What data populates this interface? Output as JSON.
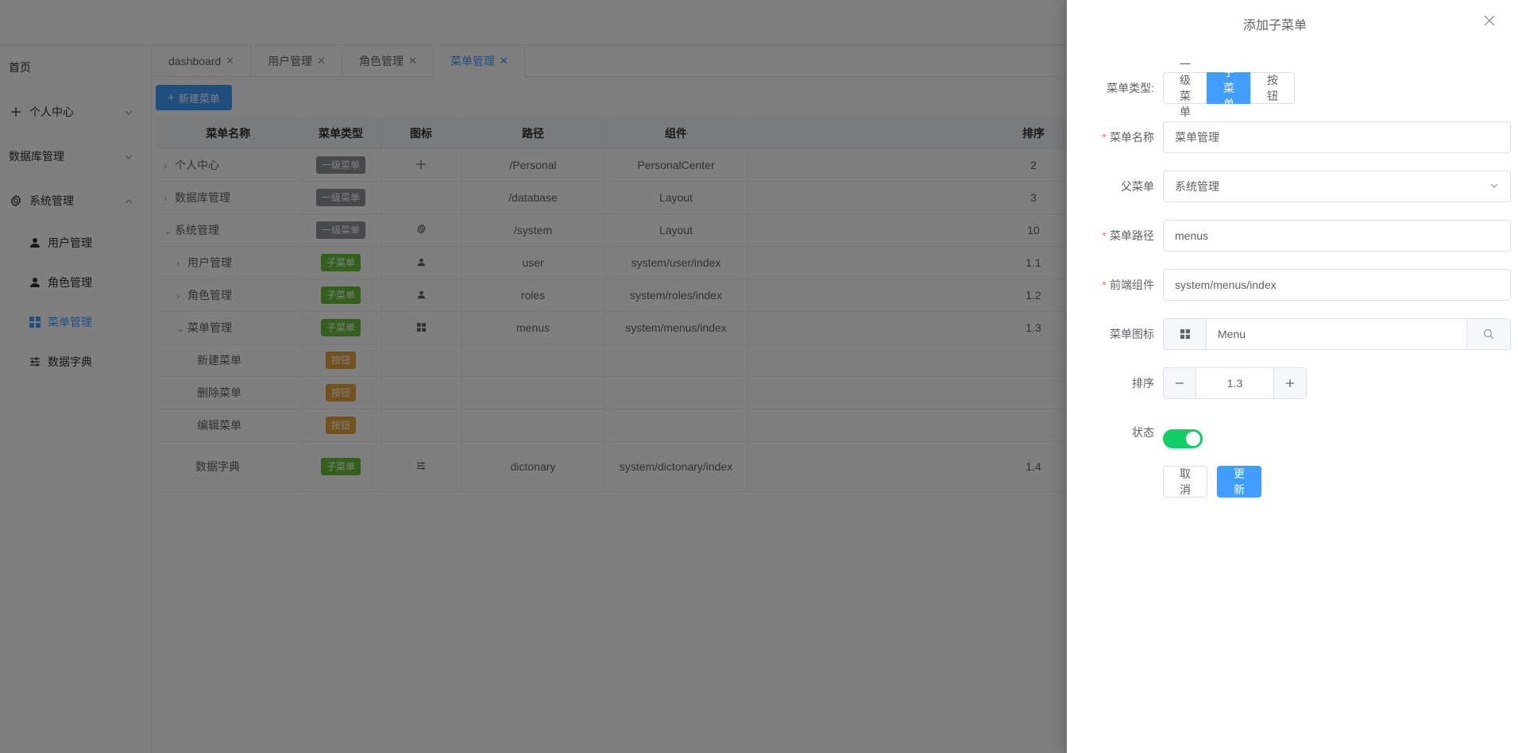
{
  "sidebar": {
    "home": "首页",
    "personal": "个人中心",
    "database": "数据库管理",
    "system": "系统管理",
    "sub_items": [
      {
        "label": "用户管理",
        "icon": "user-icon"
      },
      {
        "label": "角色管理",
        "icon": "user-icon"
      },
      {
        "label": "菜单管理",
        "icon": "grid-icon",
        "active": true
      },
      {
        "label": "数据字典",
        "icon": "sliders-icon"
      }
    ]
  },
  "tabs": [
    {
      "label": "dashboard"
    },
    {
      "label": "用户管理"
    },
    {
      "label": "角色管理"
    },
    {
      "label": "菜单管理",
      "active": true
    }
  ],
  "toolbar": {
    "new_menu": "新建菜单"
  },
  "table": {
    "headers": [
      "菜单名称",
      "菜单类型",
      "图标",
      "路径",
      "组件",
      "排序"
    ],
    "rows": [
      {
        "name": "个人中心",
        "type": "一级菜单",
        "path": "/Personal",
        "component": "PersonalCenter",
        "sort": "2"
      },
      {
        "name": "数据库管理",
        "type": "一级菜单",
        "path": "/database",
        "component": "Layout",
        "sort": "3"
      },
      {
        "name": "系统管理",
        "type": "一级菜单",
        "path": "/system",
        "component": "Layout",
        "sort": "10"
      },
      {
        "name": "用户管理",
        "type": "子菜单",
        "path": "user",
        "component": "system/user/index",
        "sort": "1.1"
      },
      {
        "name": "角色管理",
        "type": "子菜单",
        "path": "roles",
        "component": "system/roles/index",
        "sort": "1.2"
      },
      {
        "name": "菜单管理",
        "type": "子菜单",
        "path": "menus",
        "component": "system/menus/index",
        "sort": "1.3"
      },
      {
        "name": "新建菜单",
        "type": "按钮",
        "path": "",
        "component": "",
        "sort": ""
      },
      {
        "name": "删除菜单",
        "type": "按钮",
        "path": "",
        "component": "",
        "sort": ""
      },
      {
        "name": "编辑菜单",
        "type": "按钮",
        "path": "",
        "component": "",
        "sort": ""
      },
      {
        "name": "数据字典",
        "type": "子菜单",
        "path": "dictonary",
        "component": "system/dictonary/index",
        "sort": "1.4"
      }
    ]
  },
  "drawer": {
    "title": "添加子菜单",
    "type_label": "菜单类型:",
    "type_options": [
      "一级菜单",
      "子菜单",
      "按钮"
    ],
    "type_selected": "子菜单",
    "name_label": "菜单名称",
    "name_value": "菜单管理",
    "parent_label": "父菜单",
    "parent_value": "系统管理",
    "path_label": "菜单路径",
    "path_value": "menus",
    "component_label": "前端组件",
    "component_value": "system/menus/index",
    "icon_label": "菜单图标",
    "icon_value": "Menu",
    "sort_label": "排序",
    "sort_value": "1.3",
    "status_label": "状态",
    "status_on": true,
    "cancel": "取消",
    "submit": "更新"
  },
  "colors": {
    "primary": "#409eff",
    "switch_on": "#13ce66",
    "tag_gray": "#909399",
    "tag_green": "#67c23a",
    "tag_orange": "#e6a23c"
  }
}
